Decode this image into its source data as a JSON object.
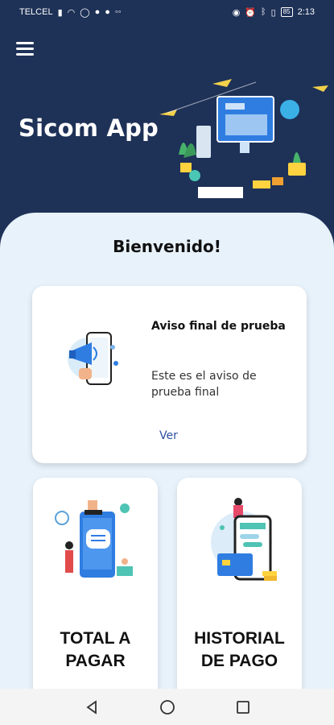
{
  "status_bar": {
    "carrier": "TELCEL",
    "battery": "85",
    "time": "2:13"
  },
  "header": {
    "app_title": "Sicom App"
  },
  "main": {
    "welcome": "Bienvenido!",
    "notice": {
      "title": "Aviso final de prueba",
      "body": "Este es el aviso de prueba final",
      "link": "Ver"
    },
    "tiles": [
      {
        "line1": "TOTAL A",
        "line2": "PAGAR"
      },
      {
        "line1": "HISTORIAL",
        "line2": "DE PAGO"
      }
    ]
  },
  "colors": {
    "header_bg": "#1e3157",
    "content_bg": "#e8f2fb",
    "link": "#2c4f9e"
  }
}
